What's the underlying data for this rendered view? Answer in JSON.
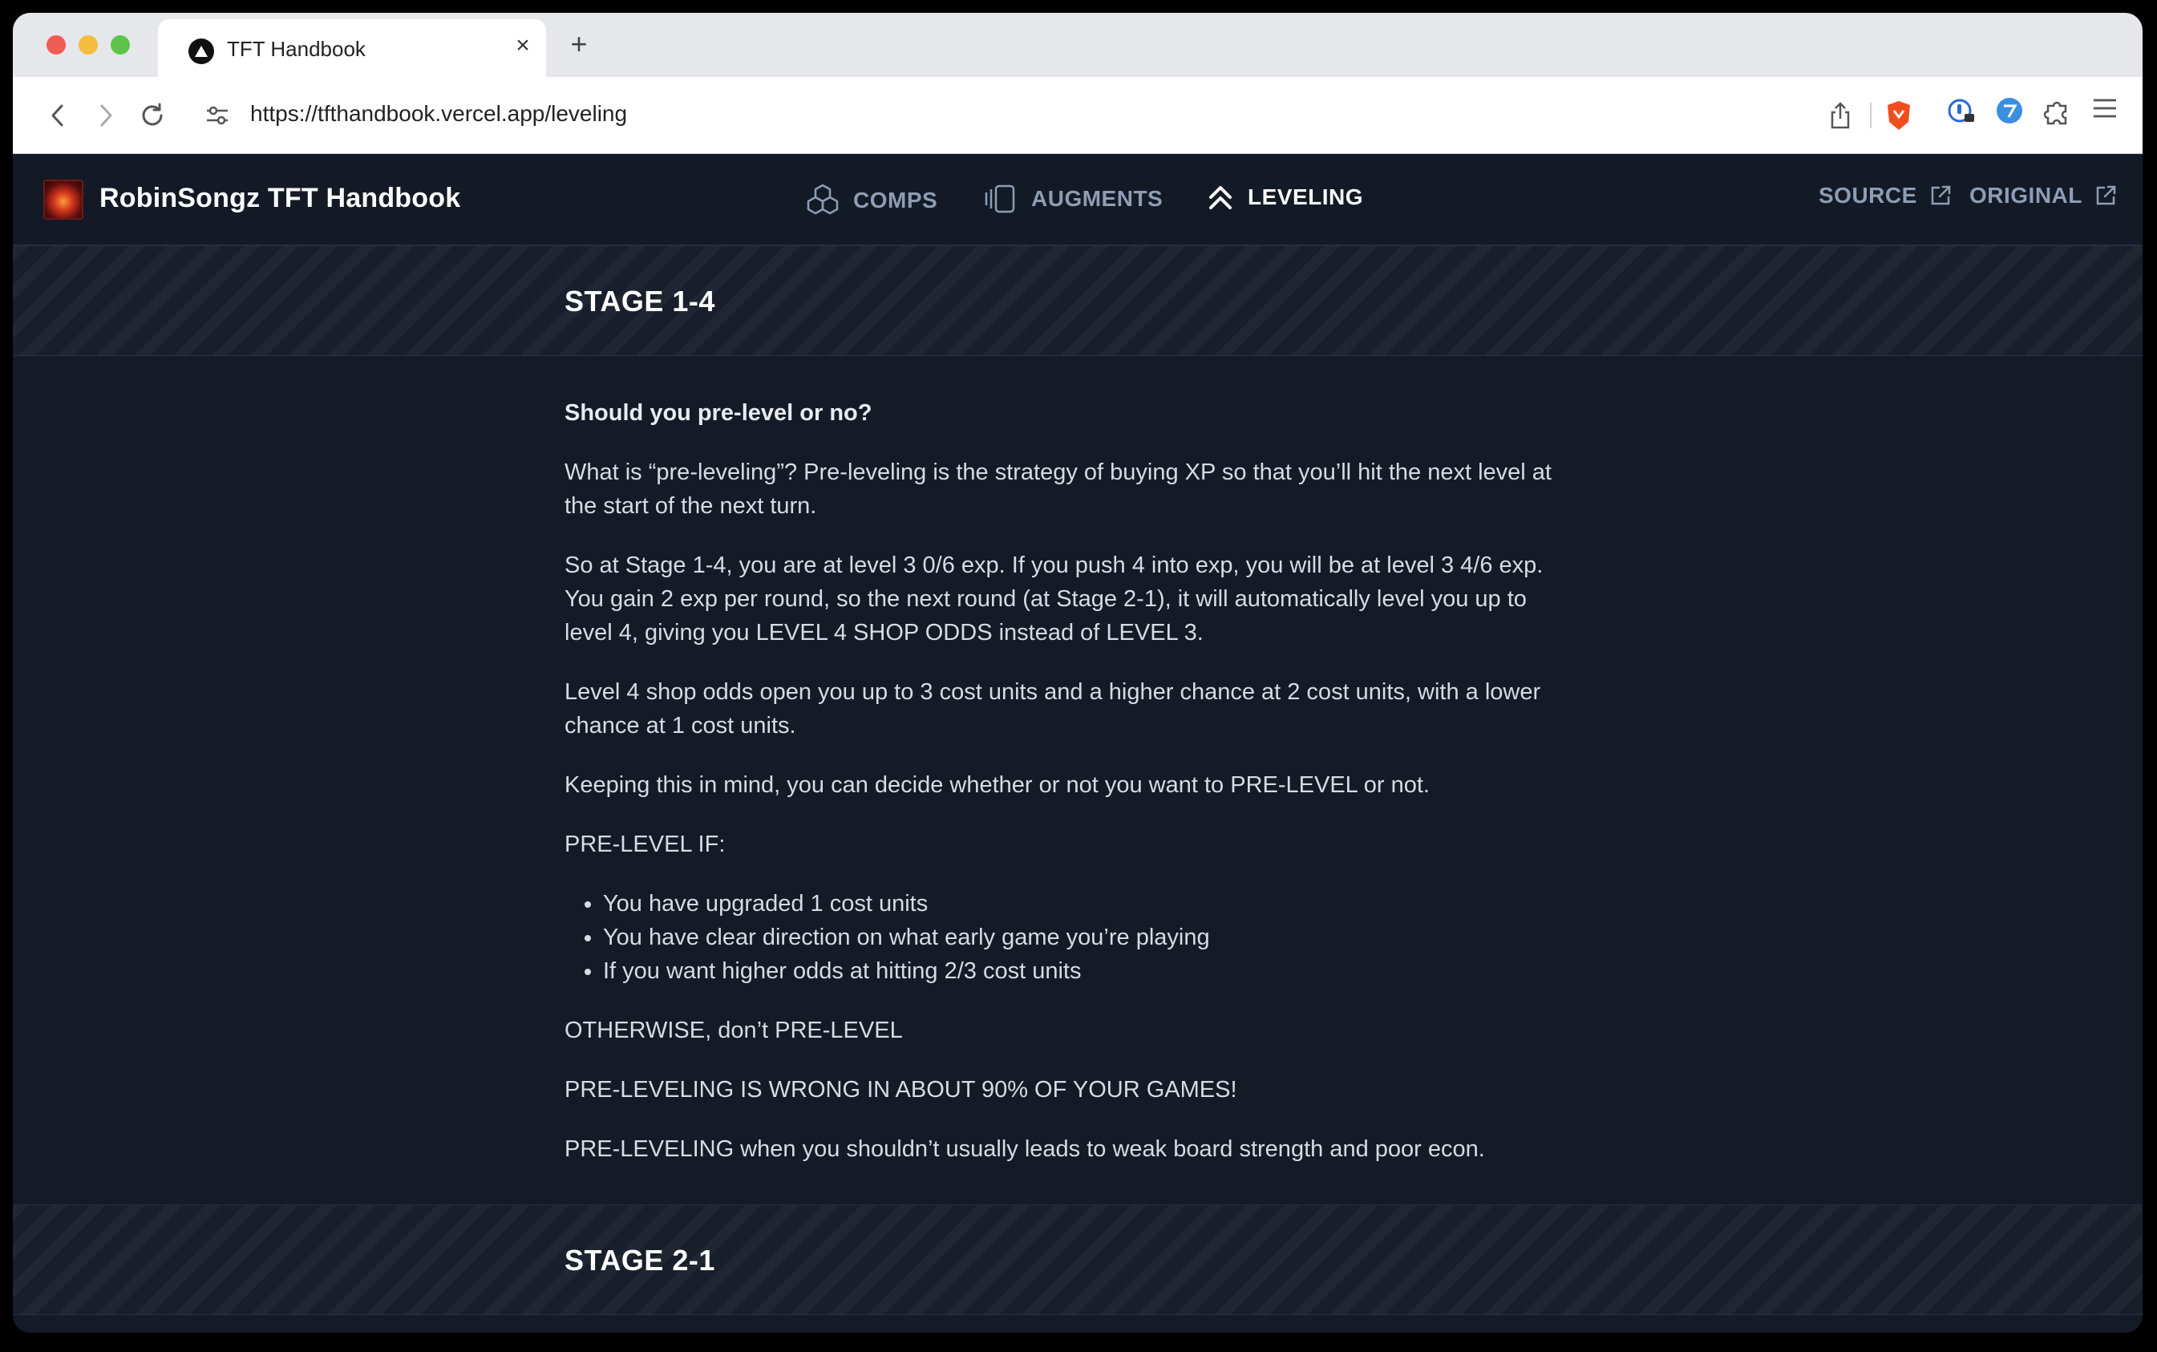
{
  "browser": {
    "tab_title": "TFT Handbook",
    "tab_close": "×",
    "new_tab": "+",
    "url": "https://tfthandbook.vercel.app/leveling"
  },
  "site": {
    "brand": "RobinSongz TFT Handbook",
    "nav": [
      {
        "label": "COMPS",
        "icon": "cubes-icon",
        "active": false
      },
      {
        "label": "AUGMENTS",
        "icon": "cards-icon",
        "active": false
      },
      {
        "label": "LEVELING",
        "icon": "double-chevron-up-icon",
        "active": true
      }
    ],
    "external": [
      {
        "label": "SOURCE",
        "icon": "external-link-icon"
      },
      {
        "label": "ORIGINAL",
        "icon": "external-link-icon"
      }
    ]
  },
  "sections": [
    {
      "title": "STAGE 1-4",
      "heading": "Should you pre-level or no?",
      "paragraphs": [
        "What is “pre-leveling”? Pre-leveling is the strategy of buying XP so that you’ll hit the next level at the start of the next turn.",
        "So at Stage 1-4, you are at level 3 0/6 exp. If you push 4 into exp, you will be at level 3 4/6 exp. You gain 2 exp per round, so the next round (at Stage 2-1), it will automatically level you up to level 4, giving you LEVEL 4 SHOP ODDS instead of LEVEL 3.",
        "Level 4 shop odds open you up to 3 cost units and a higher chance at 2 cost units, with a lower chance at 1 cost units.",
        "Keeping this in mind, you can decide whether or not you want to PRE-LEVEL or not.",
        "PRE-LEVEL IF:"
      ],
      "bullets": [
        "You have upgraded 1 cost units",
        "You have clear direction on what early game you’re playing",
        "If you want higher odds at hitting 2/3 cost units"
      ],
      "closing": [
        "OTHERWISE, don’t PRE-LEVEL",
        "PRE-LEVELING IS WRONG IN ABOUT 90% OF YOUR GAMES!",
        "PRE-LEVELING when you shouldn’t usually leads to weak board strength and poor econ."
      ]
    },
    {
      "title": "STAGE 2-1"
    }
  ]
}
